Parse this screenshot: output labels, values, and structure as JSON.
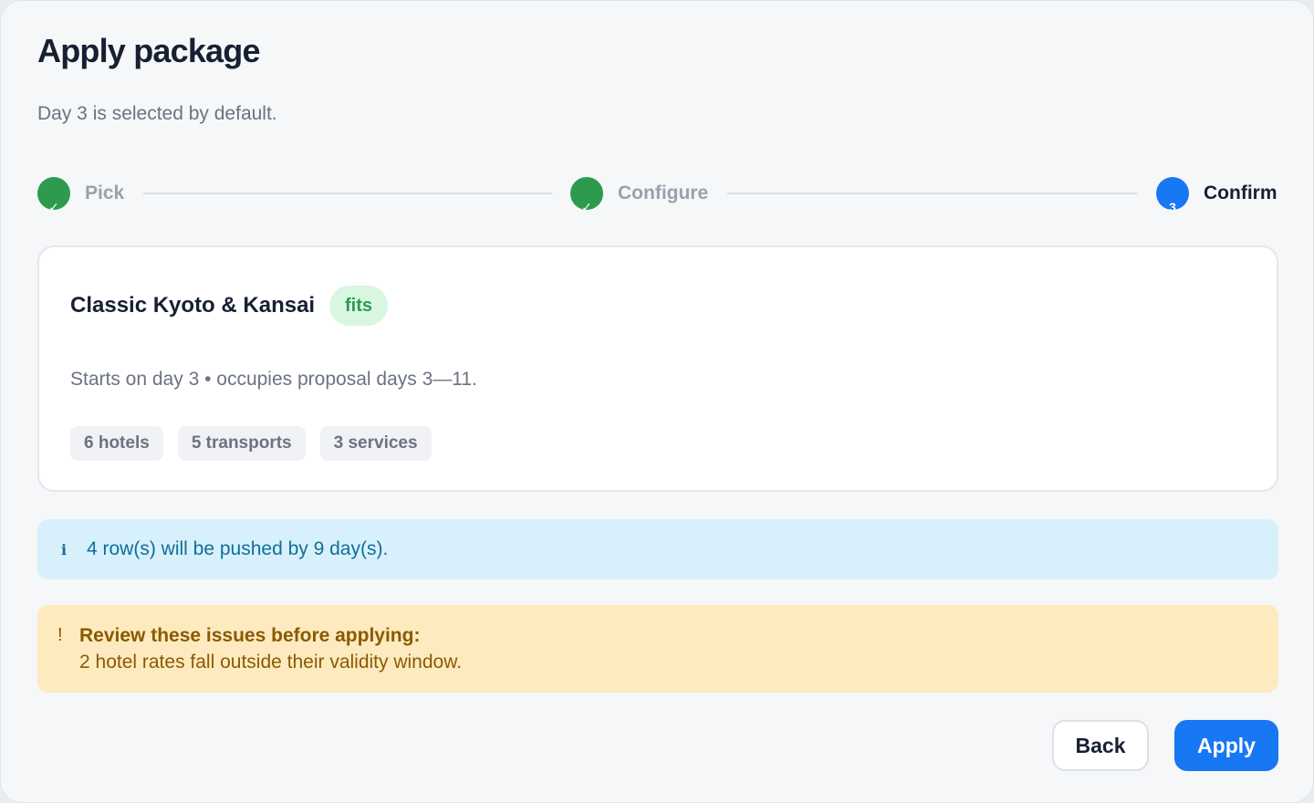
{
  "dialog": {
    "title": "Apply package",
    "subtitle": "Day 3 is selected by default."
  },
  "stepper": {
    "steps": [
      {
        "label": "Pick",
        "state": "done",
        "glyph": "✓"
      },
      {
        "label": "Configure",
        "state": "done",
        "glyph": "✓"
      },
      {
        "label": "Confirm",
        "state": "active",
        "glyph": "3"
      }
    ]
  },
  "package": {
    "name": "Classic Kyoto & Kansai",
    "badge": "fits",
    "description": "Starts on day 3 • occupies proposal days 3—11.",
    "chips": [
      "6 hotels",
      "5 transports",
      "3 services"
    ]
  },
  "info": {
    "icon": "info-icon",
    "icon_glyph": "i",
    "text": "4 row(s) will be pushed by 9 day(s)."
  },
  "warning": {
    "icon": "warning-icon",
    "icon_glyph": "!",
    "title": "Review these issues before applying:",
    "body": "2 hotel rates fall outside their validity window."
  },
  "footer": {
    "back_label": "Back",
    "apply_label": "Apply"
  },
  "colors": {
    "primary": "#1877f2",
    "success": "#2d9a4e",
    "info_bg": "#d8f0fc",
    "warning_bg": "#feeabf"
  }
}
